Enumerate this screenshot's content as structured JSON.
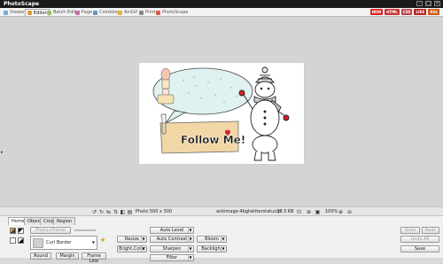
{
  "app": {
    "title": "PhotoScape"
  },
  "program_tabs": [
    {
      "label": "Viewer"
    },
    {
      "label": "Editor"
    },
    {
      "label": "Batch Editor"
    },
    {
      "label": "Page"
    },
    {
      "label": "Combine"
    },
    {
      "label": "AniGif"
    },
    {
      "label": "Print"
    },
    {
      "label": "PhotoScape"
    }
  ],
  "badges": [
    "NEW",
    "HTML",
    "CSS",
    "LIKE",
    "RSS"
  ],
  "photo": {
    "caption": "Follow Me!"
  },
  "status": {
    "photo_size": "Photo 500 x 300",
    "filename": "ankimage-4bgtwitterstatus.pr",
    "filesize": "97.3 KB",
    "zoom": "100%"
  },
  "panel": {
    "tabs": [
      "Home",
      "Object",
      "Crop",
      "Region"
    ],
    "photo_frame_label": "Photo+Frame",
    "frame_name": "Curl Border",
    "round_label": "Round",
    "margin_label": "Margin",
    "frame_line_label": "Frame Line",
    "tools": {
      "resize": "Resize",
      "bright_color": "Bright,Color",
      "auto_level": "Auto Level",
      "auto_contrast": "Auto Contrast",
      "sharpen": "Sharpen",
      "filter": "Filter",
      "bloom": "Bloom",
      "backlight": "Backlight"
    },
    "actions": {
      "undo": "Undo",
      "redo": "Redo",
      "undo_all": "Undo All",
      "save": "Save"
    }
  },
  "colors": {
    "titlebar": "#1a1a1a",
    "canvas": "#d4d4d4",
    "sticky_note": "#f1d7a6",
    "speech_bubble": "#dff1f1",
    "heart": "#d8202a"
  }
}
